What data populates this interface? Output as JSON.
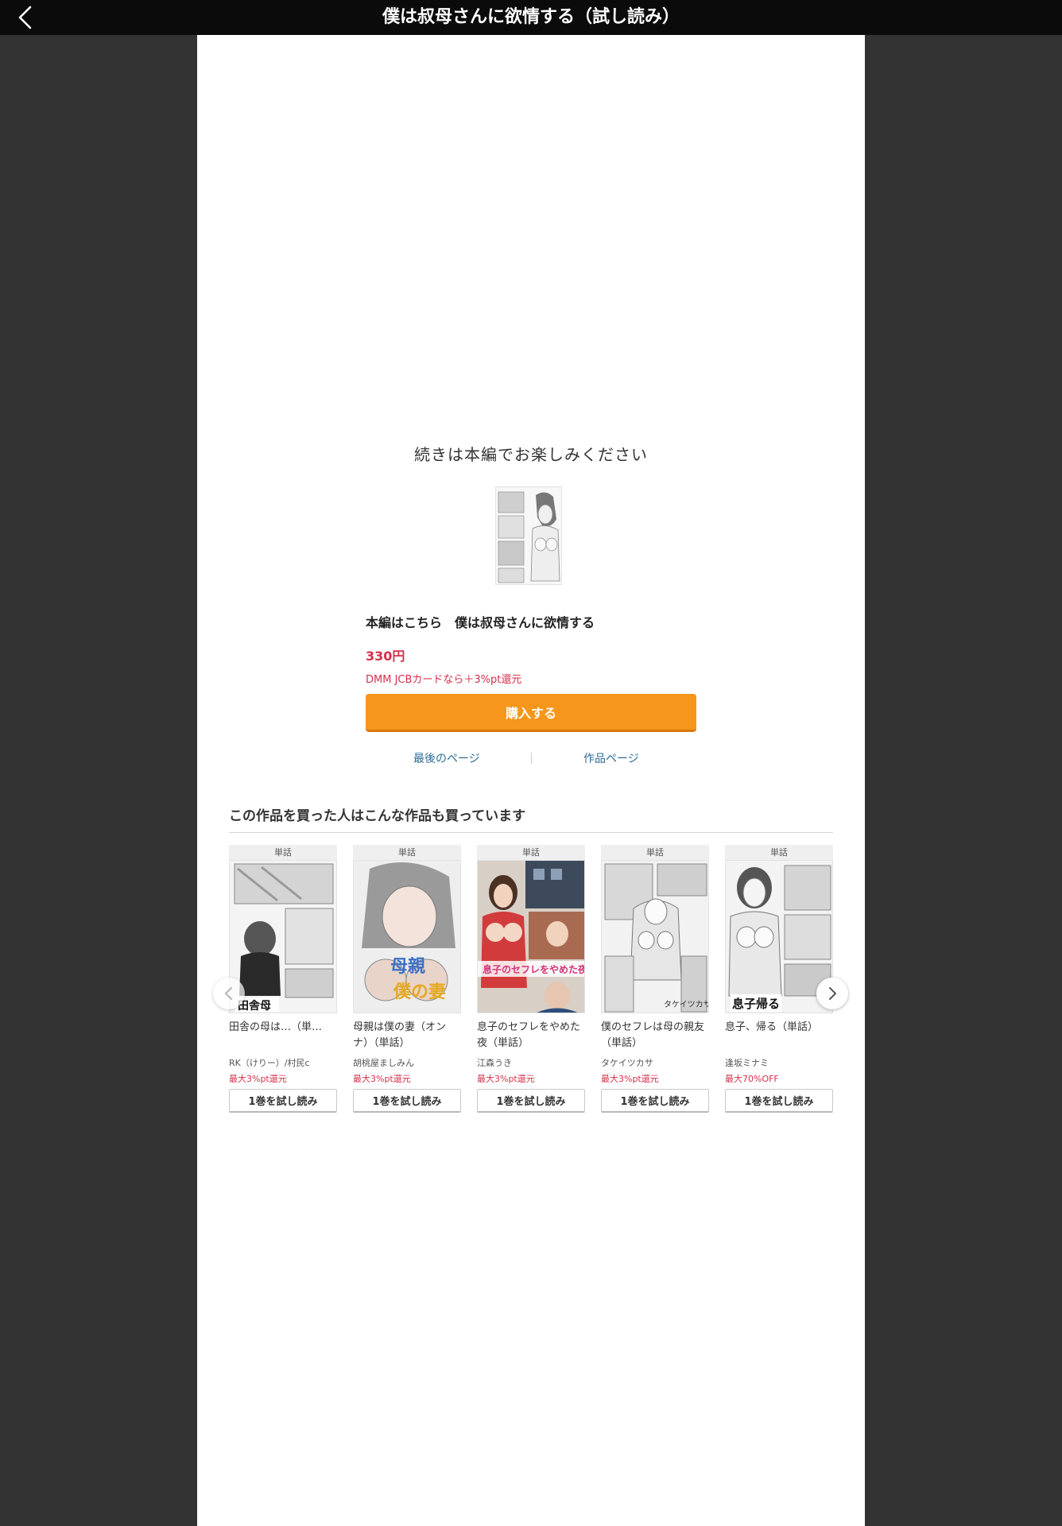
{
  "header": {
    "title": "僕は叔母さんに欲情する（試し読み）",
    "back_icon": "chevron-left-icon"
  },
  "end": {
    "continue_text": "続きは本編でお楽しみください",
    "buy_title": "本編はこちら　僕は叔母さんに欲情する",
    "price": "330円",
    "jcb_note": "DMM JCBカードなら＋3%pt還元",
    "buy_label": "購入する",
    "last_page_label": "最後のページ",
    "work_page_label": "作品ページ"
  },
  "recommend": {
    "heading": "この作品を買った人はこんな作品も買っています",
    "items": [
      {
        "tag": "単話",
        "title": "田舎の母は…（単…",
        "author": "RK（けりー）/村民c",
        "promo": "最大3%pt還元",
        "button": "1巻を試し読み"
      },
      {
        "tag": "単話",
        "title": "母親は僕の妻（オンナ）（単話）",
        "author": "胡桃屋ましみん",
        "promo": "最大3%pt還元",
        "button": "1巻を試し読み"
      },
      {
        "tag": "単話",
        "title": "息子のセフレをやめた夜（単話）",
        "author": "江森うき",
        "promo": "最大3%pt還元",
        "button": "1巻を試し読み"
      },
      {
        "tag": "単話",
        "title": "僕のセフレは母の親友（単話）",
        "author": "タケイツカサ",
        "promo": "最大3%pt還元",
        "button": "1巻を試し読み"
      },
      {
        "tag": "単話",
        "title": "息子、帰る（単話）",
        "author": "逢坂ミナミ",
        "promo": "最大70%OFF",
        "button": "1巻を試し読み"
      }
    ]
  },
  "colors": {
    "accent_orange": "#f6961a",
    "price_red": "#d6304a",
    "link_blue": "#2d6c98",
    "backdrop": "#333333"
  }
}
